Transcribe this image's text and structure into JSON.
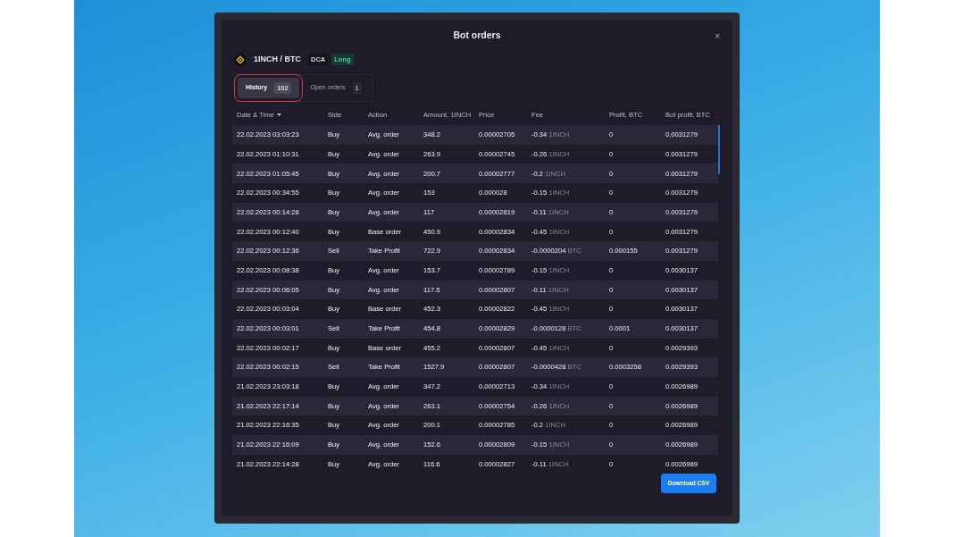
{
  "dialog": {
    "title": "Bot orders",
    "close": "×"
  },
  "pair": {
    "name": "1INCH / BTC",
    "tags": [
      {
        "label": "DCA",
        "kind": "plain"
      },
      {
        "label": "Long",
        "kind": "positive"
      }
    ]
  },
  "tabs": [
    {
      "label": "History",
      "count": "102",
      "selected": true,
      "highlighted": true
    },
    {
      "label": "Open orders",
      "count": "1",
      "selected": false,
      "highlighted": false
    }
  ],
  "table": {
    "columns": [
      {
        "label": "Date & Time",
        "sorted": true
      },
      {
        "label": "Side",
        "sorted": false
      },
      {
        "label": "Action",
        "sorted": false
      },
      {
        "label": "Amount, 1INCH",
        "sorted": false
      },
      {
        "label": "Price",
        "sorted": false
      },
      {
        "label": "Fee",
        "sorted": false
      },
      {
        "label": "Profit, BTC",
        "sorted": false
      },
      {
        "label": "Bot profit, BTC",
        "sorted": false
      }
    ],
    "rows": [
      {
        "date": "22.02.2023 03:03:23",
        "side": "Buy",
        "action": "Avg. order",
        "amount": "348.2",
        "price": "0.00002705",
        "fee": "-0.34",
        "fee_unit": "1INCH",
        "profit": "0",
        "bot_profit": "0.0031279"
      },
      {
        "date": "22.02.2023 01:10:31",
        "side": "Buy",
        "action": "Avg. order",
        "amount": "263.9",
        "price": "0.00002745",
        "fee": "-0.26",
        "fee_unit": "1INCH",
        "profit": "0",
        "bot_profit": "0.0031279"
      },
      {
        "date": "22.02.2023 01:05:45",
        "side": "Buy",
        "action": "Avg. order",
        "amount": "200.7",
        "price": "0.00002777",
        "fee": "-0.2",
        "fee_unit": "1INCH",
        "profit": "0",
        "bot_profit": "0.0031279"
      },
      {
        "date": "22.02.2023 00:34:55",
        "side": "Buy",
        "action": "Avg. order",
        "amount": "153",
        "price": "0.000028",
        "fee": "-0.15",
        "fee_unit": "1INCH",
        "profit": "0",
        "bot_profit": "0.0031279"
      },
      {
        "date": "22.02.2023 00:14:28",
        "side": "Buy",
        "action": "Avg. order",
        "amount": "117",
        "price": "0.00002819",
        "fee": "-0.11",
        "fee_unit": "1INCH",
        "profit": "0",
        "bot_profit": "0.0031279"
      },
      {
        "date": "22.02.2023 00:12:40",
        "side": "Buy",
        "action": "Base order",
        "amount": "450.9",
        "price": "0.00002834",
        "fee": "-0.45",
        "fee_unit": "1INCH",
        "profit": "0",
        "bot_profit": "0.0031279"
      },
      {
        "date": "22.02.2023 00:12:36",
        "side": "Sell",
        "action": "Take Profit",
        "amount": "722.9",
        "price": "0.00002834",
        "fee": "-0.0000204",
        "fee_unit": "BTC",
        "profit": "0.000155",
        "bot_profit": "0.0031279"
      },
      {
        "date": "22.02.2023 00:08:38",
        "side": "Buy",
        "action": "Avg. order",
        "amount": "153.7",
        "price": "0.00002789",
        "fee": "-0.15",
        "fee_unit": "1INCH",
        "profit": "0",
        "bot_profit": "0.0030137"
      },
      {
        "date": "22.02.2023 00:06:05",
        "side": "Buy",
        "action": "Avg. order",
        "amount": "117.5",
        "price": "0.00002807",
        "fee": "-0.11",
        "fee_unit": "1INCH",
        "profit": "0",
        "bot_profit": "0.0030137"
      },
      {
        "date": "22.02.2023 00:03:04",
        "side": "Buy",
        "action": "Base order",
        "amount": "452.3",
        "price": "0.00002822",
        "fee": "-0.45",
        "fee_unit": "1INCH",
        "profit": "0",
        "bot_profit": "0.0030137"
      },
      {
        "date": "22.02.2023 00:03:01",
        "side": "Sell",
        "action": "Take Profit",
        "amount": "454.8",
        "price": "0.00002829",
        "fee": "-0.0000128",
        "fee_unit": "BTC",
        "profit": "0.0001",
        "bot_profit": "0.0030137"
      },
      {
        "date": "22.02.2023 00:02:17",
        "side": "Buy",
        "action": "Base order",
        "amount": "455.2",
        "price": "0.00002807",
        "fee": "-0.45",
        "fee_unit": "1INCH",
        "profit": "0",
        "bot_profit": "0.0029393"
      },
      {
        "date": "22.02.2023 00:02:15",
        "side": "Sell",
        "action": "Take Profit",
        "amount": "1527.9",
        "price": "0.00002807",
        "fee": "-0.0000428",
        "fee_unit": "BTC",
        "profit": "0.0003258",
        "bot_profit": "0.0029393"
      },
      {
        "date": "21.02.2023 23:03:18",
        "side": "Buy",
        "action": "Avg. order",
        "amount": "347.2",
        "price": "0.00002713",
        "fee": "-0.34",
        "fee_unit": "1INCH",
        "profit": "0",
        "bot_profit": "0.0026989"
      },
      {
        "date": "21.02.2023 22:17:14",
        "side": "Buy",
        "action": "Avg. order",
        "amount": "263.1",
        "price": "0.00002754",
        "fee": "-0.26",
        "fee_unit": "1INCH",
        "profit": "0",
        "bot_profit": "0.0026989"
      },
      {
        "date": "21.02.2023 22:16:35",
        "side": "Buy",
        "action": "Avg. order",
        "amount": "200.1",
        "price": "0.00002785",
        "fee": "-0.2",
        "fee_unit": "1INCH",
        "profit": "0",
        "bot_profit": "0.0026989"
      },
      {
        "date": "21.02.2023 22:16:09",
        "side": "Buy",
        "action": "Avg. order",
        "amount": "152.6",
        "price": "0.00002809",
        "fee": "-0.15",
        "fee_unit": "1INCH",
        "profit": "0",
        "bot_profit": "0.0026989"
      },
      {
        "date": "21.02.2023 22:14:28",
        "side": "Buy",
        "action": "Avg. order",
        "amount": "116.6",
        "price": "0.00002827",
        "fee": "-0.11",
        "fee_unit": "1INCH",
        "profit": "0",
        "bot_profit": "0.0026989"
      }
    ]
  },
  "download_button": "Download CSV"
}
